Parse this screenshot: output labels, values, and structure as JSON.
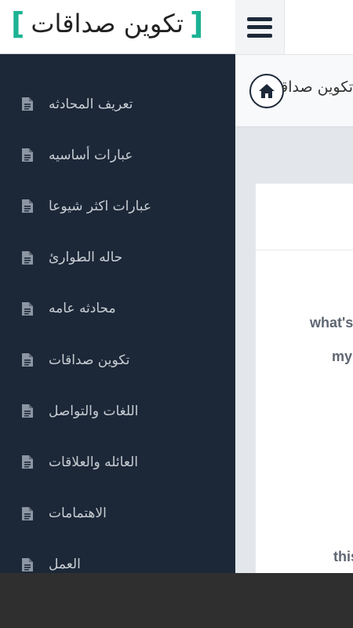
{
  "app": {
    "title": "تكوين صداقات",
    "accent_color": "#1bb394"
  },
  "topbar": {
    "menu_icon": "hamburger-icon"
  },
  "breadcrumb": {
    "home_icon": "home-icon",
    "text": "تكوين صداقات"
  },
  "sidebar": {
    "items": [
      {
        "label": "تعريف المحادثه",
        "icon": "document-icon"
      },
      {
        "label": "عبارات أساسيه",
        "icon": "document-icon"
      },
      {
        "label": "عبارات اكثر شيوعا",
        "icon": "document-icon"
      },
      {
        "label": "حاله الطوارئ",
        "icon": "document-icon"
      },
      {
        "label": "محادثه عامه",
        "icon": "document-icon"
      },
      {
        "label": "تكوين صداقات",
        "icon": "document-icon"
      },
      {
        "label": "اللغات والتواصل",
        "icon": "document-icon"
      },
      {
        "label": "العائله والعلاقات",
        "icon": "document-icon"
      },
      {
        "label": "الاهتمامات",
        "icon": "document-icon"
      },
      {
        "label": "العمل",
        "icon": "document-icon"
      }
    ]
  },
  "content": {
    "lines": [
      "what's",
      "my",
      "this"
    ]
  }
}
